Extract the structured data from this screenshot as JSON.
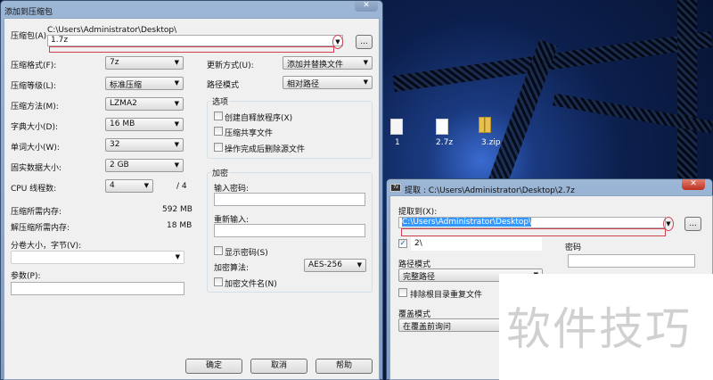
{
  "desktop": {
    "icons": [
      {
        "label": "1",
        "type": "file"
      },
      {
        "label": "2.7z",
        "type": "file"
      },
      {
        "label": "3.zip",
        "type": "zip-folder"
      }
    ]
  },
  "add_dialog": {
    "title": "添加到压缩包",
    "archive_label": "压缩包(A)",
    "archive_path": "C:\\Users\\Administrator\\Desktop\\",
    "archive_name": "1.7z",
    "browse_label": "...",
    "rows": [
      {
        "label": "压缩格式(F):",
        "value": "7z"
      },
      {
        "label": "压缩等级(L):",
        "value": "标准压缩"
      },
      {
        "label": "压缩方法(M):",
        "value": "LZMA2"
      },
      {
        "label": "字典大小(D):",
        "value": "16 MB"
      },
      {
        "label": "单词大小(W):",
        "value": "32"
      },
      {
        "label": "固实数据大小:",
        "value": "2 GB"
      }
    ],
    "cpu_label": "CPU 线程数:",
    "cpu_value": "4",
    "cpu_max": "/ 4",
    "mem_compress_label": "压缩所需内存:",
    "mem_compress": "592 MB",
    "mem_decompress_label": "解压缩所需内存:",
    "mem_decompress": "18 MB",
    "split_label": "分卷大小，字节(V):",
    "split_value": "",
    "params_label": "参数(P):",
    "params_value": "",
    "update_label": "更新方式(U):",
    "update_value": "添加并替换文件",
    "pathmode_label": "路径模式",
    "pathmode_value": "相对路径",
    "options_title": "选项",
    "options": [
      {
        "label": "创建自释放程序(X)",
        "checked": false
      },
      {
        "label": "压缩共享文件",
        "checked": false
      },
      {
        "label": "操作完成后删除源文件",
        "checked": false
      }
    ],
    "encrypt_title": "加密",
    "password_label": "输入密码:",
    "password_value": "",
    "reenter_label": "重新输入:",
    "reenter_value": "",
    "show_password": "显示密码(S)",
    "algo_label": "加密算法:",
    "algo_value": "AES-256",
    "encrypt_names": "加密文件名(N)",
    "ok": "确定",
    "cancel": "取消",
    "help": "帮助"
  },
  "extract_dialog": {
    "title": "提取 : C:\\Users\\Administrator\\Desktop\\2.7z",
    "extract_to_label": "提取到(X):",
    "extract_to_value": "C:\\Users\\Administrator\\Desktop\\",
    "browse_label": "...",
    "subfolder_checked": true,
    "subfolder_value": "2\\",
    "password_label": "密码",
    "password_value": "",
    "pathmode_label": "路径模式",
    "pathmode_value": "完整路径",
    "exclude_label": "排除根目录重复文件",
    "overwrite_label": "覆盖模式",
    "overwrite_value": "在覆盖前询问"
  },
  "watermark": "软件技巧"
}
